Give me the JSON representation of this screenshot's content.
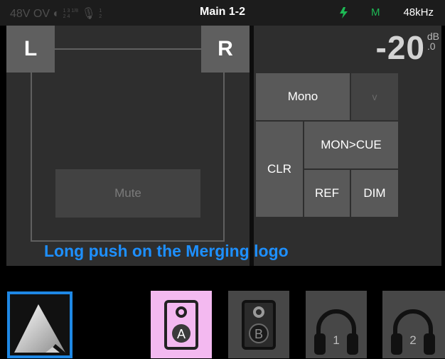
{
  "status": {
    "phantom": "48V",
    "overload": "OV",
    "grid_top": "1 3 1/8",
    "grid_bottom": "2 4",
    "mic_top": "1",
    "mic_bottom": "2",
    "title": "Main 1-2",
    "mode_letter": "M",
    "sample_rate": "48kHz"
  },
  "left_panel": {
    "left_label": "L",
    "right_label": "R",
    "mute_label": "Mute"
  },
  "readout": {
    "value": "-20",
    "unit": "dB",
    "decimal": ".0"
  },
  "buttons": {
    "mono": "Mono",
    "v": "v",
    "clr": "CLR",
    "mon_cue": "MON>CUE",
    "ref": "REF",
    "dim": "DIM"
  },
  "hint": "Long push on the Merging logo",
  "bottom": {
    "speaker_a": "A",
    "speaker_b": "B",
    "headphone_1": "1",
    "headphone_2": "2"
  },
  "colors": {
    "accent_blue": "#1e88e5",
    "hint_blue": "#1e90ff",
    "active_pink": "#f3b9f0",
    "status_green": "#1db954"
  }
}
